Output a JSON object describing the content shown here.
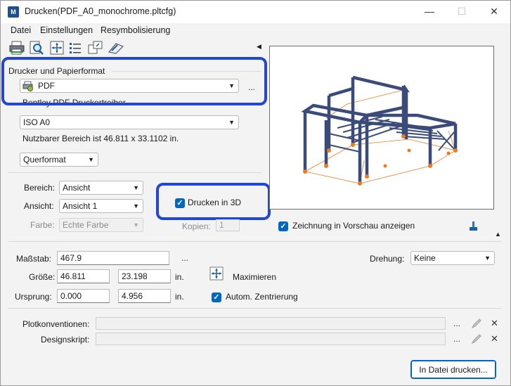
{
  "window": {
    "title": "Drucken(PDF_A0_monochrome.pltcfg)",
    "minimize_glyph": "—",
    "maximize_glyph": "☐",
    "close_glyph": "✕"
  },
  "menu": {
    "datei": "Datei",
    "einstellungen": "Einstellungen",
    "resymbolisierung": "Resymbolisierung"
  },
  "printer": {
    "group_title": "Drucker und Papierformat",
    "printer_value": "PDF",
    "driver_text": "Bentley PDF Druckertreiber",
    "paper_value": "ISO A0",
    "usable_area": "Nutzbarer Bereich ist 46.811 x 33.1102 in.",
    "orientation_value": "Querformat",
    "more": "..."
  },
  "options": {
    "bereich_label": "Bereich:",
    "bereich_value": "Ansicht",
    "ansicht_label": "Ansicht:",
    "ansicht_value": "Ansicht 1",
    "farbe_label": "Farbe:",
    "farbe_value": "Echte Farbe",
    "drucken_3d": "Drucken in 3D",
    "kopien_label": "Kopien:",
    "kopien_value": "1",
    "zeichnung_vorschau": "Zeichnung in Vorschau anzeigen"
  },
  "scale": {
    "massstab_label": "Maßstab:",
    "massstab_value": "467.9",
    "groesse_label": "Größe:",
    "groesse_w": "46.811",
    "groesse_h": "23.198",
    "ursprung_label": "Ursprung:",
    "ursprung_x": "0.000",
    "ursprung_y": "4.956",
    "unit": "in.",
    "drehung_label": "Drehung:",
    "drehung_value": "Keine",
    "maximieren": "Maximieren",
    "zentrierung": "Autom. Zentrierung",
    "more": "..."
  },
  "conventions": {
    "plot_label": "Plotkonventionen:",
    "design_label": "Designskript:",
    "more": "..."
  },
  "actions": {
    "print_to_file": "In Datei drucken..."
  },
  "colors": {
    "highlight": "#2446d6",
    "accent": "#0067c0",
    "steel": "#3a4b7a",
    "orange": "#ee7b22"
  }
}
